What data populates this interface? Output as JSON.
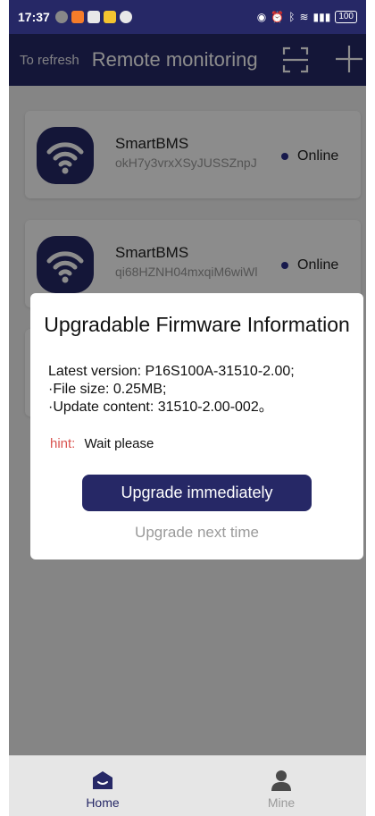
{
  "statusbar": {
    "time": "17:37",
    "battery": "100"
  },
  "header": {
    "refresh_label": "To refresh",
    "title": "Remote monitoring"
  },
  "devices": [
    {
      "name": "SmartBMS",
      "serial": "okH7y3vrxXSyJUSSZnpJ",
      "status": "Online"
    },
    {
      "name": "SmartBMS",
      "serial": "qi68HZNH04mxqiM6wiWl",
      "status": "Online"
    }
  ],
  "dialog": {
    "title": "Upgradable Firmware Information",
    "latest_version": "Latest version:  P16S100A-31510-2.00;",
    "file_size": "·File size:  0.25MB;",
    "update_content": "·Update content:  31510-2.00-002。",
    "hint_label": "hint:",
    "hint_text": "Wait please",
    "upgrade_button": "Upgrade immediately",
    "later_button": "Upgrade next time"
  },
  "nav": {
    "home_label": "Home",
    "mine_label": "Mine"
  },
  "colors": {
    "primary": "#262866",
    "hint": "#d9534f",
    "muted": "#9a9a9a"
  }
}
